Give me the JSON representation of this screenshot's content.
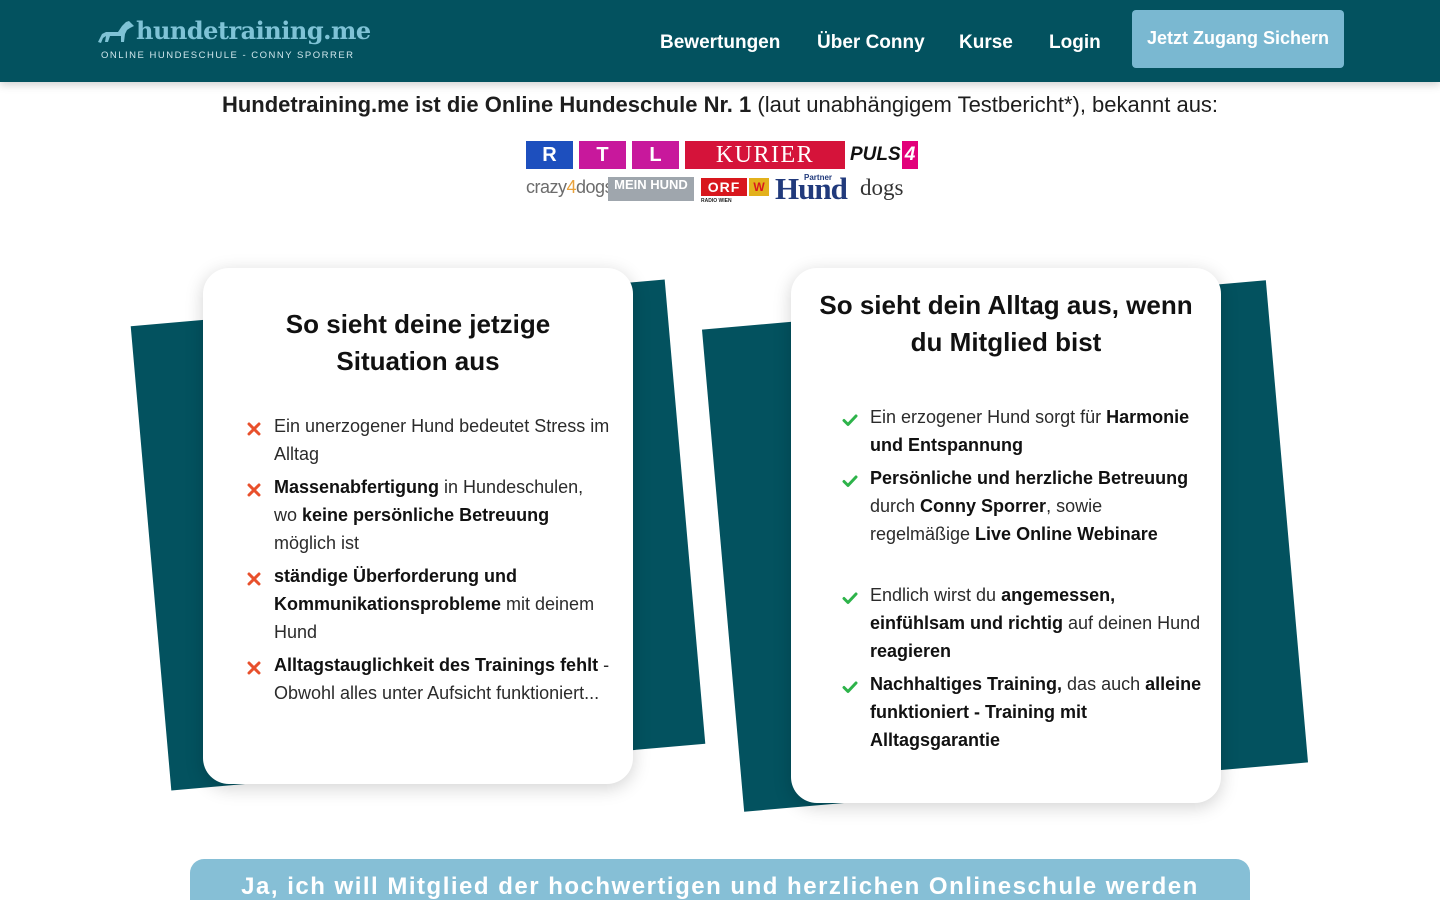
{
  "nav": {
    "logo_name": "hundetraining.me",
    "logo_sub": "ONLINE HUNDESCHULE - CONNY SPORRER",
    "links": [
      "Bewertungen",
      "Über Conny",
      "Kurse",
      "Login"
    ],
    "cta": "Jetzt Zugang Sichern"
  },
  "headline": {
    "bold": "Hundetraining.me ist die Online Hundeschule Nr. 1",
    "rest": " (laut unabhängigem Testbericht*), bekannt aus:"
  },
  "media": {
    "rtl": [
      "R",
      "T",
      "L"
    ],
    "kurier": "KURIER",
    "puls": "PULS",
    "puls_num": "4",
    "crazy": "crazy",
    "crazy_a": "4",
    "crazy_dogs": "dogs",
    "meinhund": "MEIN HUND",
    "orf": "ORF",
    "orf_w": "W",
    "orf_sub": "RADIO WIEN",
    "partner": "Partner",
    "hund": "Hund",
    "dogs": "dogs"
  },
  "card_left": {
    "title": "So sieht deine jetzige Situation aus",
    "items": [
      [
        {
          "t": "Ein unerzogener Hund bedeutet Stress im Alltag",
          "b": false
        }
      ],
      [
        {
          "t": "Massenabfertigung",
          "b": true
        },
        {
          "t": " in Hundeschulen, wo ",
          "b": false
        },
        {
          "t": "keine persönliche Betreuung",
          "b": true
        },
        {
          "t": " möglich ist",
          "b": false
        }
      ],
      [
        {
          "t": "ständige Überforderung und Kommunikationsprobleme",
          "b": true
        },
        {
          "t": " mit deinem Hund",
          "b": false
        }
      ],
      [
        {
          "t": "Alltagstauglichkeit des Trainings fehlt",
          "b": true
        },
        {
          "t": " - Obwohl alles unter Aufsicht funktioniert...",
          "b": false
        }
      ]
    ]
  },
  "card_right": {
    "title": "So sieht dein Alltag aus, wenn du Mitglied bist",
    "items": [
      [
        {
          "t": "Ein erzogener Hund sorgt  für ",
          "b": false
        },
        {
          "t": "Harmonie und Entspannung",
          "b": true
        }
      ],
      [
        {
          "t": "Persönliche und herzliche Betreuung",
          "b": true
        },
        {
          "t": " durch ",
          "b": false
        },
        {
          "t": "Conny Sporrer",
          "b": true
        },
        {
          "t": ", sowie regelmäßige ",
          "b": false
        },
        {
          "t": "Live Online Webinare",
          "b": true
        }
      ],
      [
        {
          "t": "Endlich wirst du ",
          "b": false
        },
        {
          "t": "angemessen, einfühlsam und richtig",
          "b": true
        },
        {
          "t": " auf deinen Hund ",
          "b": false
        },
        {
          "t": "reagieren",
          "b": true
        }
      ],
      [
        {
          "t": "Nachhaltiges Training,",
          "b": true
        },
        {
          "t": " das auch ",
          "b": false
        },
        {
          "t": "alleine funktioniert - Training mit Alltagsgarantie",
          "b": true
        }
      ]
    ]
  },
  "cta_bottom": "Ja, ich will Mitglied der hochwertigen und herzlichen Onlineschule werden",
  "colors": {
    "teal": "#03525f",
    "light_blue": "#7ab8d1",
    "cross": "#e8502c",
    "check": "#2db34a"
  }
}
